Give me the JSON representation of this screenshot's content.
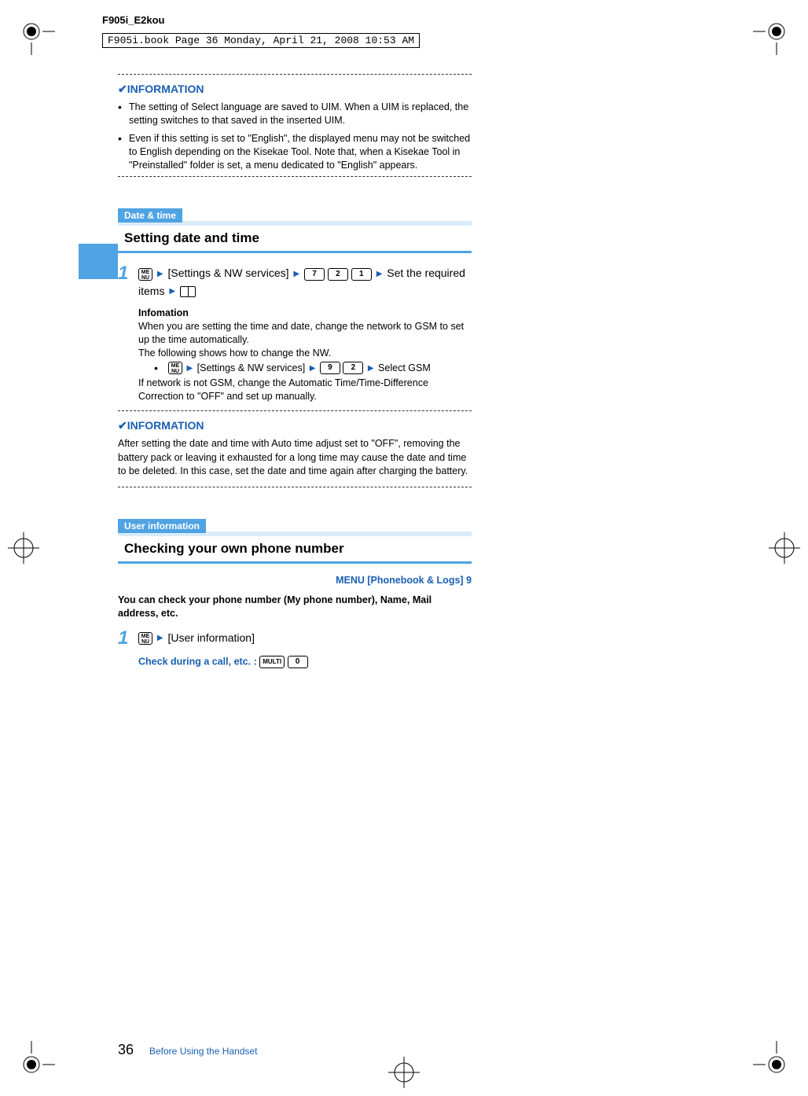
{
  "page": {
    "running_head": "F905i_E2kou",
    "book_stamp": "F905i.book  Page 36  Monday, April 21, 2008  10:53 AM",
    "number": "36",
    "footer": "Before Using the Handset"
  },
  "info1": {
    "header": "INFORMATION",
    "bullets": [
      "The setting of Select language are saved to UIM. When a UIM is replaced, the setting switches to that saved in the inserted UIM.",
      "Even if this setting is set to \"English\", the displayed menu may not be switched to English depending on the Kisekae Tool. Note that, when a Kisekae Tool in \"Preinstalled\" folder is set, a menu dedicated to \"English\" appears."
    ]
  },
  "section1": {
    "tag": "Date & time",
    "title": "Setting date and time",
    "step1_intro": "[Settings & NW services]",
    "step1_mid": "Set the required items",
    "keys1": [
      "7",
      "2",
      "1"
    ],
    "info_head": "Infomation",
    "info_p1": "When you are setting the time and date, change the network to GSM to set up the time automatically.",
    "info_p2": "The following shows how to change the NW.",
    "sub_path": "[Settings & NW services]",
    "sub_keys": [
      "9",
      "2"
    ],
    "sub_tail": "Select GSM",
    "info_p3": "If network is not GSM, change the Automatic Time/Time-Difference Correction to \"OFF\" and set up manually."
  },
  "info2": {
    "header": "INFORMATION",
    "body": "After setting the date and time with Auto time adjust set to \"OFF\", removing the battery pack or leaving it exhausted for a long time may cause the date and time to be deleted. In this case, set the date and time again after charging the battery."
  },
  "section2": {
    "tag": "User information",
    "title": "Checking your own phone number",
    "menu_ref": "MENU [Phonebook & Logs] 9",
    "intro": "You can check your phone number (My phone number), Name, Mail address, etc.",
    "step1": "[User information]",
    "check_label": "Check during a call, etc. : ",
    "check_keys": [
      "MULTI",
      "0"
    ]
  }
}
